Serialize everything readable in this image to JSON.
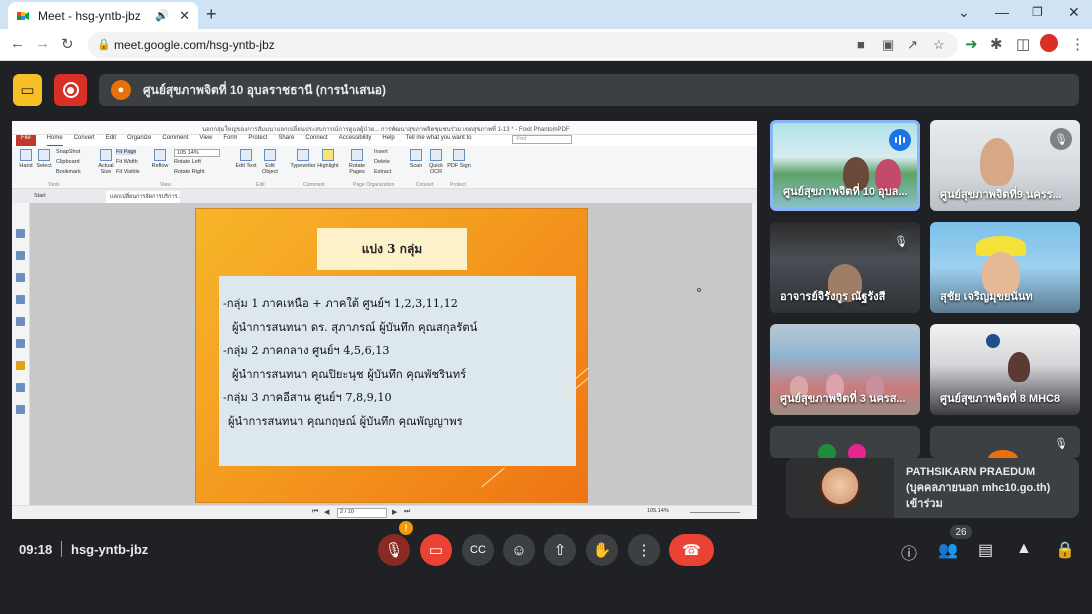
{
  "browser": {
    "tab_title": "Meet - hsg-yntb-jbz",
    "new_tab": "+",
    "url": "meet.google.com/hsg-yntb-jbz"
  },
  "meeting": {
    "presenter_label": "ศูนย์สุขภาพจิตที่ 10 อุบลราชธานี (การนำเสนอ)",
    "time": "09:18",
    "code": "hsg-yntb-jbz",
    "participant_count": "26"
  },
  "pdf": {
    "title": "นอกกลุ่มใหญ่ของการสัมมนาแลกเปลี่ยนประสบการณ์การดูแลผู้ป่วย... การพัฒนาสุขภาพจิตชุมชนร่วม เขตสุขภาพที่ 1-13 * - Foxit PhantomPDF",
    "menu": [
      "File",
      "Home",
      "Convert",
      "Edit",
      "Organize",
      "Comment",
      "View",
      "Form",
      "Protect",
      "Share",
      "Connect",
      "Accessibility",
      "Help",
      "Tell me what you want to"
    ],
    "find_placeholder": "Find",
    "ribbon": {
      "hand": "Hand",
      "select": "Select",
      "snapshot": "SnapShot",
      "clipboard": "Clipboard",
      "bookmark": "Bookmark",
      "actual_size": "Actual Size",
      "fit_page": "Fit Page",
      "fit_width": "Fit Width",
      "fit_visible": "Fit Visible",
      "reflow": "Reflow",
      "zoom": "105.14%",
      "rotate_left": "Rotate Left",
      "rotate_right": "Rotate Right",
      "edit_text": "Edit Text",
      "edit_object": "Edit Object",
      "typewriter": "Typewriter",
      "highlight": "Highlight",
      "rotate_pages": "Rotate Pages",
      "insert": "Insert",
      "delete": "Delete",
      "extract": "Extract",
      "scan": "Scan",
      "quick_ocr": "Quick OCR",
      "pdf_sign": "PDF Sign",
      "groups": [
        "Tools",
        "View",
        "Edit",
        "Comment",
        "Page Organization",
        "Convert",
        "Protect"
      ]
    },
    "tabs": [
      "Start",
      "แลกเปลี่ยนการจัดการบริการ..."
    ],
    "page_indicator": "2 / 10",
    "zoom_status": "105.14%"
  },
  "slide": {
    "title": "แบ่ง 3 กลุ่ม",
    "lines": [
      "-กลุ่ม 1 ภาคเหนือ + ภาคใต้ ศูนย์ฯ 1,2,3,11,12",
      "ผู้นำการสนทนา  ดร. สุภาภรณ์ ผู้บันทึก คุณสกุลรัตน์",
      "-กลุ่ม 2 ภาคกลาง ศูนย์ฯ 4,5,6,13",
      "ผู้นำการสนทนา คุณปิยะนุช ผู้บันทึก คุณพัชรินทร์",
      "-กลุ่ม 3 ภาคอีสาน ศูนย์ฯ 7,8,9,10",
      "ผู้นำการสนทนา คุณกฤษณ์ ผู้บันทึก คุณพัญญาพร"
    ]
  },
  "tiles": [
    {
      "name": "ศูนย์สุขภาพจิตที่ 10 อุบล...",
      "state": "speaking"
    },
    {
      "name": "ศูนย์สุขภาพจิตที่9 นครร...",
      "state": "muted"
    },
    {
      "name": "อาจารย์จิรังกูร ณัฐรังสี",
      "state": "muted"
    },
    {
      "name": "สุชัย เจริญมุขยนันท",
      "state": "unmuted"
    },
    {
      "name": "ศูนย์สุขภาพจิตที่ 3 นครส...",
      "state": "unmuted"
    },
    {
      "name": "ศูนย์สุขภาพจิตที่ 8 MHC8",
      "state": "unmuted"
    }
  ],
  "toast": {
    "name": "PATHSIKARN PRAEDUM",
    "org": "(บุคคลภายนอก mhc10.go.th)",
    "status": "เข้าร่วม"
  },
  "colors": {
    "meet_bg": "#202124",
    "hangup": "#ea4335",
    "active_tile": "#8ab4f8",
    "slide_orange": "#f49b1f"
  }
}
